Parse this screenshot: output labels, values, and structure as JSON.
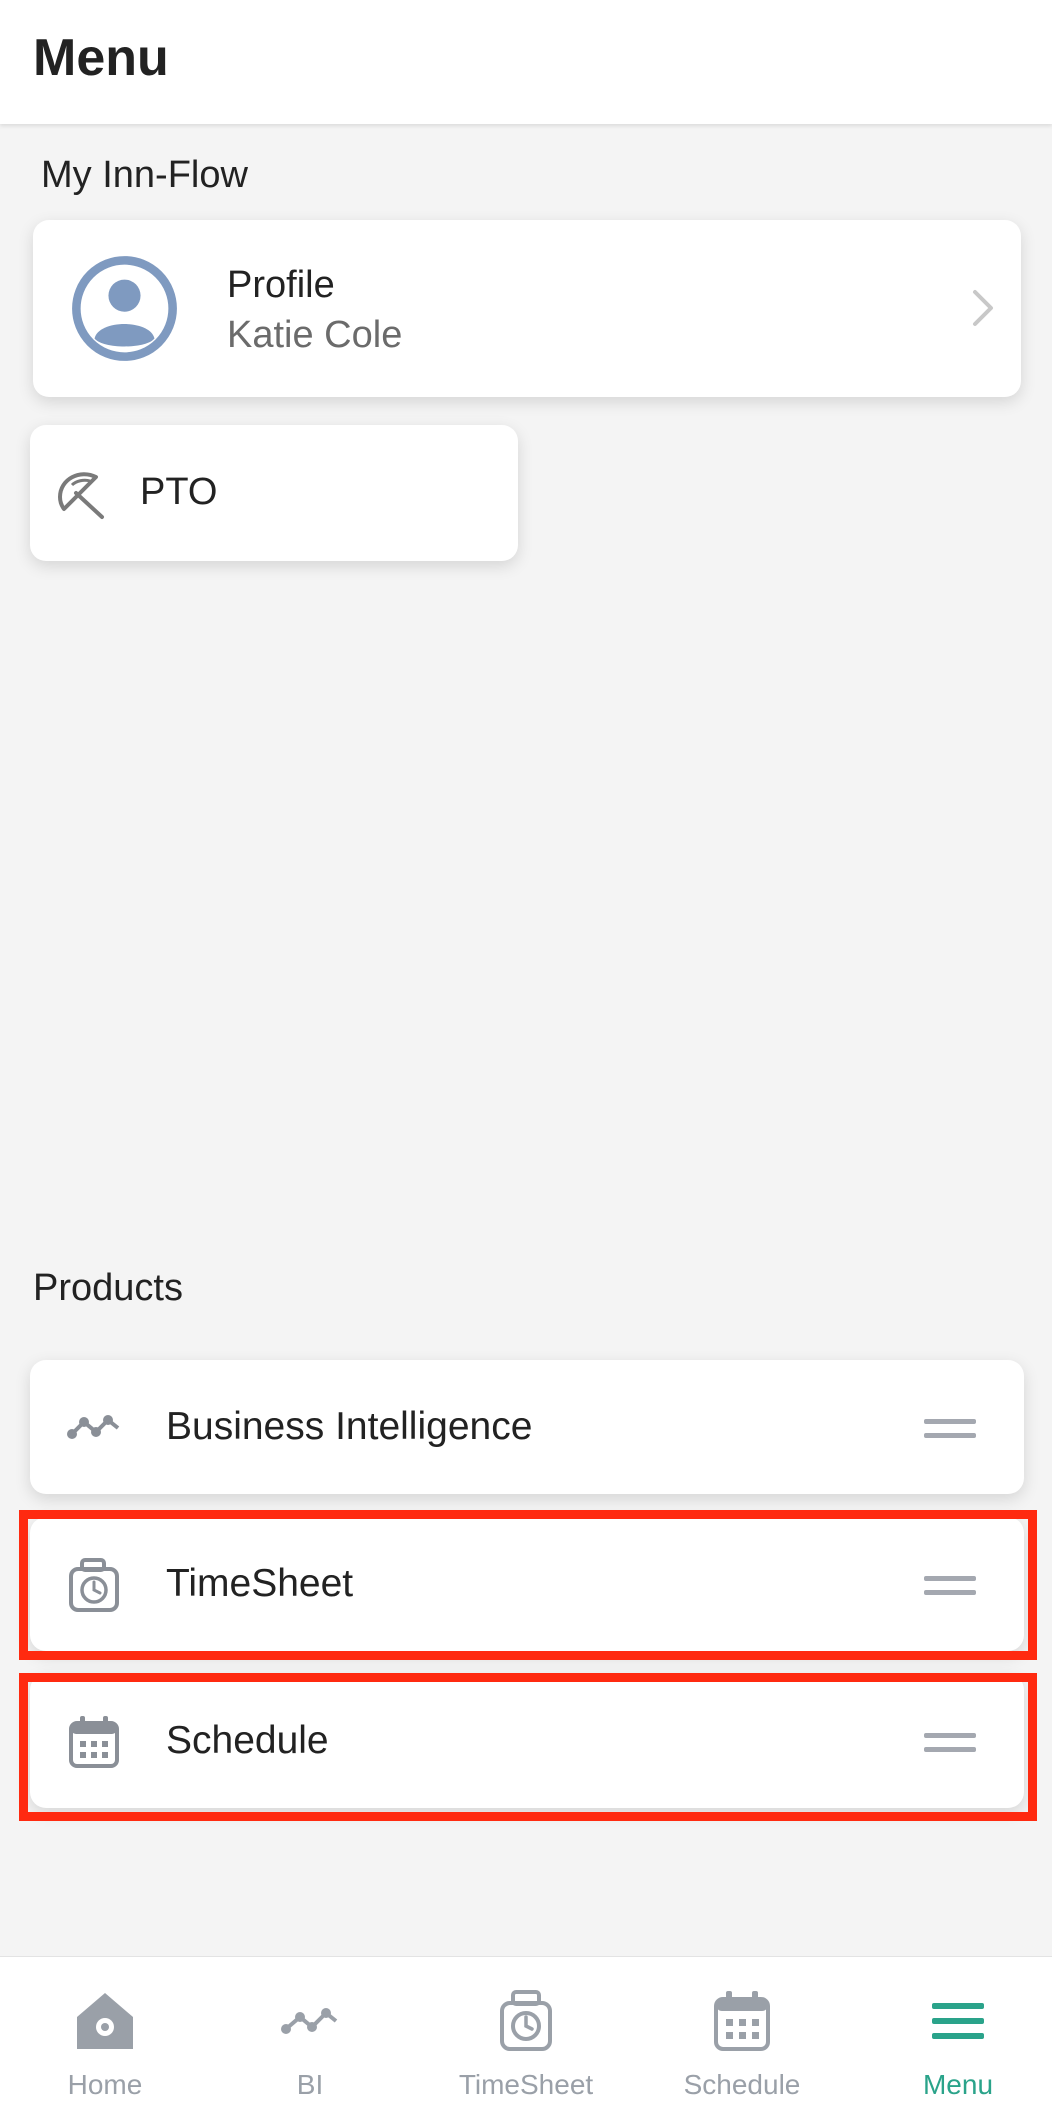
{
  "header": {
    "title": "Menu"
  },
  "my_section": {
    "label": "My Inn-Flow",
    "profile": {
      "title": "Profile",
      "name": "Katie Cole"
    },
    "pto": {
      "label": "PTO"
    }
  },
  "products": {
    "label": "Products",
    "items": [
      {
        "label": "Business Intelligence",
        "icon": "trend-line-icon"
      },
      {
        "label": "TimeSheet",
        "icon": "clock-badge-icon"
      },
      {
        "label": "Schedule",
        "icon": "calendar-icon"
      }
    ]
  },
  "tabbar": {
    "tabs": [
      {
        "label": "Home",
        "icon": "home-icon"
      },
      {
        "label": "BI",
        "icon": "trend-line-icon"
      },
      {
        "label": "TimeSheet",
        "icon": "clock-badge-icon"
      },
      {
        "label": "Schedule",
        "icon": "calendar-icon"
      },
      {
        "label": "Menu",
        "icon": "menu-icon"
      }
    ],
    "active": "Menu"
  },
  "colors": {
    "accent": "#2aa38a",
    "icon_gray": "#9aa0a8",
    "avatar_blue": "#7f9ac0",
    "highlight": "#ff2a10"
  }
}
